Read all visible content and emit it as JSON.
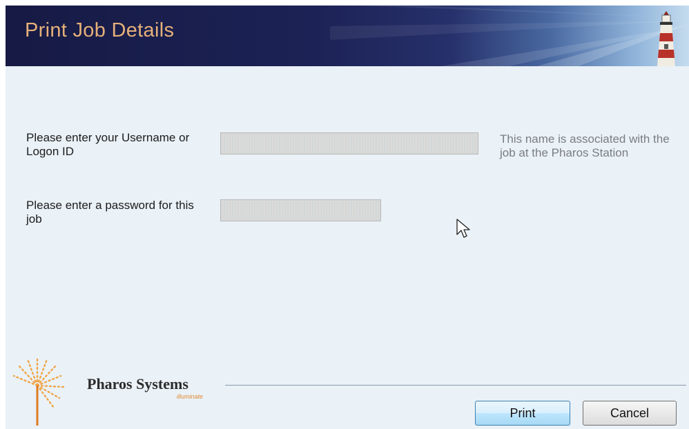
{
  "header": {
    "title": "Print Job Details"
  },
  "form": {
    "username_label": "Please enter your Username or Logon ID",
    "username_value": "",
    "username_hint": "This name is associated with the job at the Pharos Station",
    "password_label": "Please enter a password for this job",
    "password_value": ""
  },
  "branding": {
    "name": "Pharos Systems",
    "tagline": "illuminate"
  },
  "buttons": {
    "print": "Print",
    "cancel": "Cancel"
  },
  "icons": {
    "header": "lighthouse-icon",
    "brand": "pharos-burst-icon",
    "pointer": "mouse-cursor-icon"
  },
  "colors": {
    "banner": "#1c2255",
    "title": "#e6b07a",
    "background": "#eaf1f7",
    "hint": "#7a7d82",
    "brand_accent": "#e08a30"
  }
}
